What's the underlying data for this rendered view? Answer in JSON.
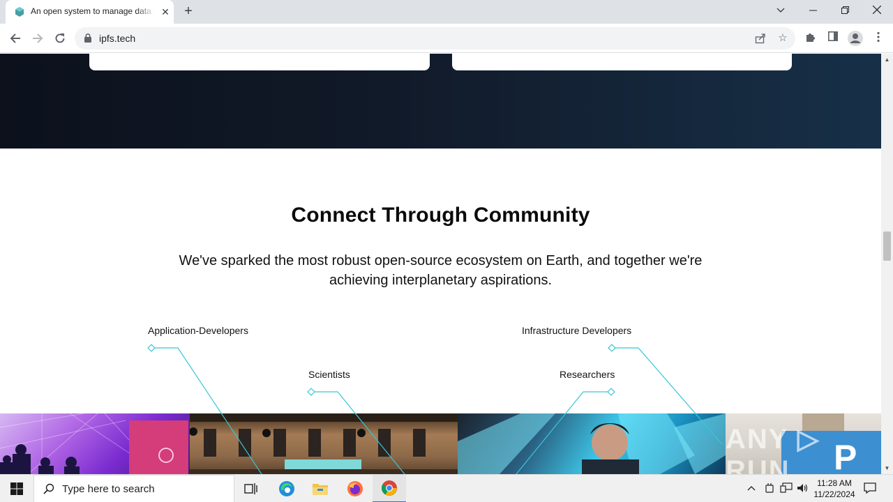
{
  "browser": {
    "tab_title": "An open system to manage data without a central server",
    "new_tab_symbol": "+",
    "url": "ipfs.tech"
  },
  "page": {
    "section_title": "Connect Through Community",
    "section_subtitle": "We've sparked the most robust open-source ecosystem on Earth, and together we're achieving interplanetary aspirations.",
    "roles": [
      "Application-Developers",
      "Scientists",
      "Infrastructure Developers",
      "Researchers"
    ],
    "photos": [
      "dome-event",
      "conference-hall",
      "speaker-portrait",
      "street-booth"
    ],
    "watermark": "ANY RUN"
  },
  "taskbar": {
    "search_placeholder": "Type here to search",
    "time": "11:28 AM",
    "date": "11/22/2024"
  },
  "colors": {
    "accent_line": "#37c6d6",
    "dark_band_start": "#0c111c",
    "dark_band_end": "#173048"
  }
}
